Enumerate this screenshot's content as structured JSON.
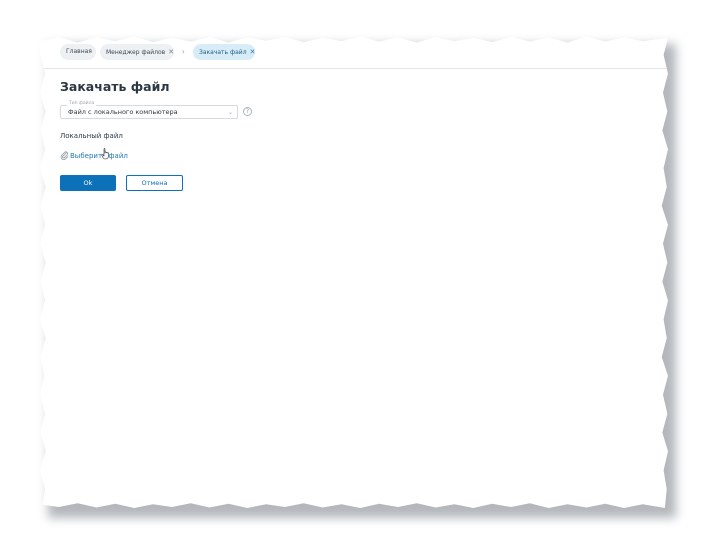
{
  "tabs": {
    "home": "Главная",
    "file_manager": "Менеджер файлов",
    "upload": "Закачать файл",
    "close_glyph": "✕",
    "separator_glyph": "›"
  },
  "page": {
    "title": "Закачать файл"
  },
  "file_type": {
    "label": "Тип файла",
    "value": "Файл с локального компьютера",
    "arrow_glyph": "⌄",
    "help_glyph": "?"
  },
  "local_file": {
    "label": "Локальный файл",
    "link": "Выберите файл"
  },
  "buttons": {
    "ok": "Ok",
    "cancel": "Отмена"
  },
  "colors": {
    "accent": "#0c71b8",
    "link": "#1f7bb6",
    "active_tab_bg": "#d7ecf7"
  },
  "icons": {
    "clip": "paperclip-icon",
    "help": "question-circle-icon",
    "cursor": "hand-pointer-cursor-icon"
  }
}
